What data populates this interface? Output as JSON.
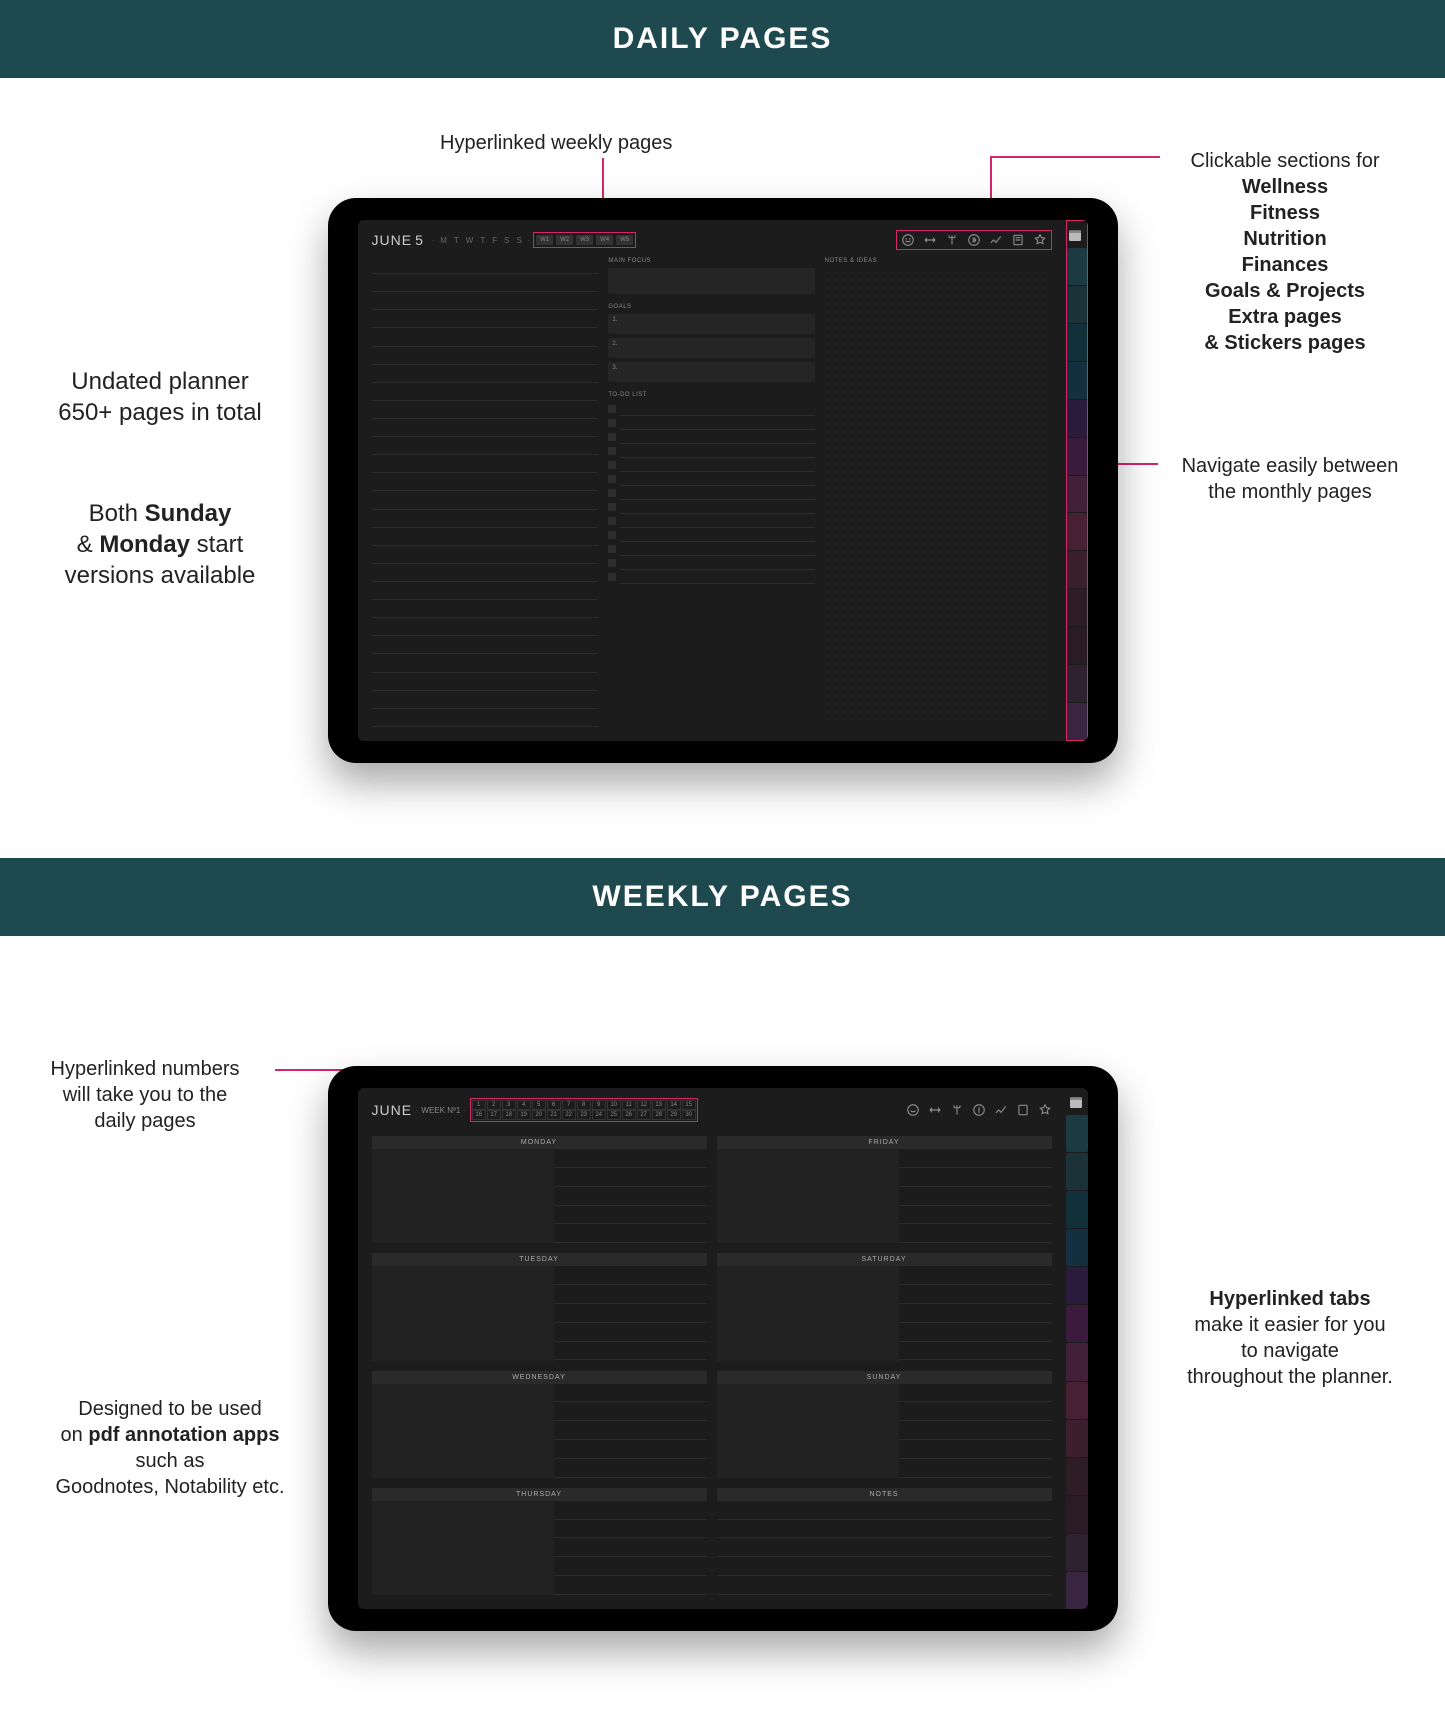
{
  "banners": {
    "daily": "DAILY PAGES",
    "weekly": "WEEKLY PAGES"
  },
  "daily": {
    "header": {
      "month": "JUNE",
      "day": "5",
      "dow": [
        "M",
        "T",
        "W",
        "T",
        "F",
        "S",
        "S"
      ],
      "weeks": [
        "W1",
        "W2",
        "W3",
        "W4",
        "W5"
      ]
    },
    "labels": {
      "main_focus": "MAIN FOCUS",
      "goals": "GOALS",
      "todo": "TO-DO LIST",
      "notes": "NOTES & IDEAS"
    },
    "goals_numbers": [
      "1.",
      "2.",
      "3."
    ],
    "icons": [
      "wellness",
      "fitness",
      "nutrition",
      "finances",
      "goals",
      "extra",
      "stickers"
    ],
    "side_colors": [
      "#1c3a42",
      "#1a3238",
      "#11303a",
      "#143040",
      "#2b1b3d",
      "#3a1b3d",
      "#43203a",
      "#472034",
      "#3b1f2c",
      "#2f1d26",
      "#2b1b24",
      "#2e2230",
      "#3a2540",
      "#2e2e2e"
    ]
  },
  "weekly": {
    "header": {
      "month": "JUNE",
      "week_label": "WEEK Nº1"
    },
    "calendar_rows": [
      [
        "1",
        "2",
        "3",
        "4",
        "5",
        "6",
        "7",
        "8",
        "9",
        "10",
        "11",
        "12",
        "13",
        "14",
        "15"
      ],
      [
        "16",
        "17",
        "18",
        "19",
        "20",
        "21",
        "22",
        "23",
        "24",
        "25",
        "26",
        "27",
        "28",
        "29",
        "30"
      ]
    ],
    "days_left": [
      "MONDAY",
      "TUESDAY",
      "WEDNESDAY",
      "THURSDAY"
    ],
    "days_right": [
      "FRIDAY",
      "SATURDAY",
      "SUNDAY",
      "NOTES"
    ],
    "icons": [
      "wellness",
      "fitness",
      "nutrition",
      "finances",
      "goals",
      "extra",
      "stickers"
    ],
    "side_colors": [
      "#1c3a42",
      "#1a3238",
      "#11303a",
      "#143040",
      "#2b1b3d",
      "#3a1b3d",
      "#43203a",
      "#472034",
      "#3b1f2c",
      "#2f1d26",
      "#2b1b24",
      "#2e2230",
      "#3a2540",
      "#2e2e2e"
    ]
  },
  "annotations": {
    "hyperlinked_weekly": "Hyperlinked weekly pages",
    "clickable_intro": "Clickable sections for",
    "clickable_list": [
      "Wellness",
      "Fitness",
      "Nutrition",
      "Finances",
      "Goals & Projects",
      "Extra pages",
      "& Stickers pages"
    ],
    "undated_l1": "Undated planner",
    "undated_l2": "650+ pages in total",
    "start_l1_a": "Both ",
    "start_l1_b": "Sunday",
    "start_l2_a": "& ",
    "start_l2_b": "Monday",
    "start_l2_c": " start",
    "start_l3": "versions available",
    "navigate_l1": "Navigate easily between",
    "navigate_l2": "the monthly pages",
    "hl_numbers_l1": "Hyperlinked numbers",
    "hl_numbers_l2": "will take you to the",
    "hl_numbers_l3": "daily pages",
    "tabs_l1": "Hyperlinked tabs",
    "tabs_l2": "make it easier for you",
    "tabs_l3": "to navigate",
    "tabs_l4": "throughout the planner.",
    "pdf_l1": "Designed to be used",
    "pdf_l2_a": "on ",
    "pdf_l2_b": "pdf annotation apps",
    "pdf_l3": "such as",
    "pdf_l4": "Goodnotes, Notability etc."
  }
}
